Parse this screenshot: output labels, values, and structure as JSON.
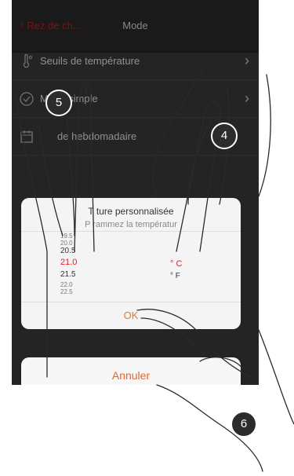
{
  "navbar": {
    "back_label": "Rez de ch...",
    "title": "Mode"
  },
  "menu": {
    "items": [
      {
        "label": "Seuils de  température",
        "icon": "thermometer-icon"
      },
      {
        "label": "Mode simple",
        "icon": "check-circle-icon"
      },
      {
        "label": "de hebdomadaire",
        "icon": "calendar-icon"
      }
    ]
  },
  "dialog": {
    "title": "T        ture personnalisée",
    "subtitle": "P        rammez la températur",
    "values_above": [
      "19.5",
      "20.0",
      "20.5"
    ],
    "selected_value": "21.0",
    "values_below": [
      "21.5",
      "22.0",
      "22.5"
    ],
    "units": [
      "° C",
      "° F"
    ],
    "selected_unit": "° C",
    "ok_label": "OK"
  },
  "cancel_label": "Annuler",
  "badges": [
    "5",
    "4",
    "6"
  ],
  "colors": {
    "accent_red": "#d6262b",
    "accent_orange": "#e07b3a",
    "dark_bg": "#3a3a3a"
  }
}
